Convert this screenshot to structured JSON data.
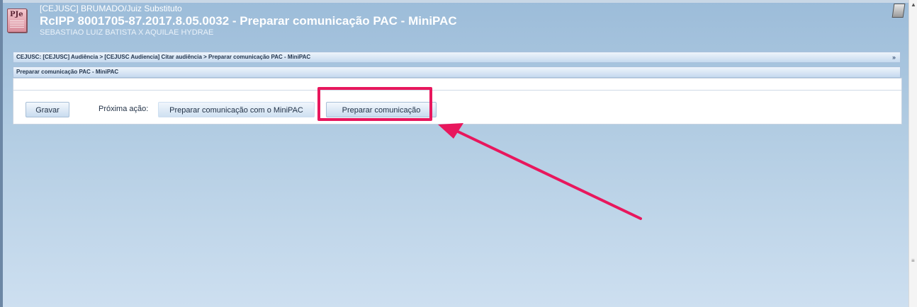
{
  "header": {
    "line1": "[CEJUSC] BRUMADO/Juiz Substituto",
    "title": "RcIPP 8001705-87.2017.8.05.0032 - Preparar comunicação PAC - MiniPAC",
    "parties": "SEBASTIAO LUIZ BATISTA X AQUILAE HYDRAE",
    "app_icon_text": "PJe"
  },
  "breadcrumb": {
    "text": "CEJUSC: [CEJUSC] Audiência > [CEJUSC Audiencia] Citar audiência > Preparar comunicação PAC - MiniPAC",
    "more": "»"
  },
  "subheader": {
    "text": "Preparar comunicação PAC - MiniPAC"
  },
  "actions": {
    "save_label": "Gravar",
    "next_action_label": "Próxima ação:",
    "minipac_label": "Preparar comunicação com o MiniPAC",
    "prepare_label": "Preparar comunicação"
  },
  "colors": {
    "highlight": "#e8175d",
    "background_top": "#9cbcd9",
    "background_bottom": "#cddff0"
  },
  "icons": [
    "pje-app-icon",
    "document-icon",
    "arrow-annotation",
    "scroll-up-icon"
  ]
}
